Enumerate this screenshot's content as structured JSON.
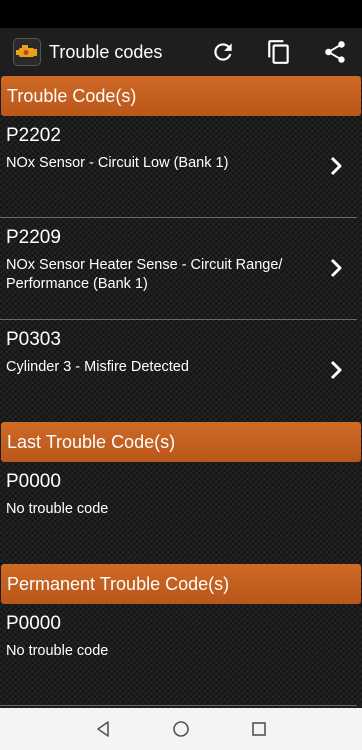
{
  "app_bar": {
    "title": "Trouble codes",
    "actions": [
      "refresh-icon",
      "copy-icon",
      "share-icon"
    ]
  },
  "colors": {
    "accent": "#c45f1f",
    "app_bar": "#1e1e1e",
    "nav_bar": "#f4f4f4"
  },
  "sections": [
    {
      "title": "Trouble Code(s)",
      "items": [
        {
          "code": "P2202",
          "description": "NOx Sensor - Circuit Low (Bank 1)"
        },
        {
          "code": "P2209",
          "description": "NOx Sensor Heater Sense - Circuit Range/ Performance (Bank 1)"
        },
        {
          "code": "P0303",
          "description": "Cylinder 3 - Misfire Detected"
        }
      ]
    },
    {
      "title": "Last Trouble Code(s)",
      "items": [
        {
          "code": "P0000",
          "description": "No trouble code"
        }
      ]
    },
    {
      "title": "Permanent Trouble Code(s)",
      "items": [
        {
          "code": "P0000",
          "description": "No trouble code"
        }
      ]
    }
  ],
  "nav": [
    "back-icon",
    "home-icon",
    "recents-icon"
  ]
}
